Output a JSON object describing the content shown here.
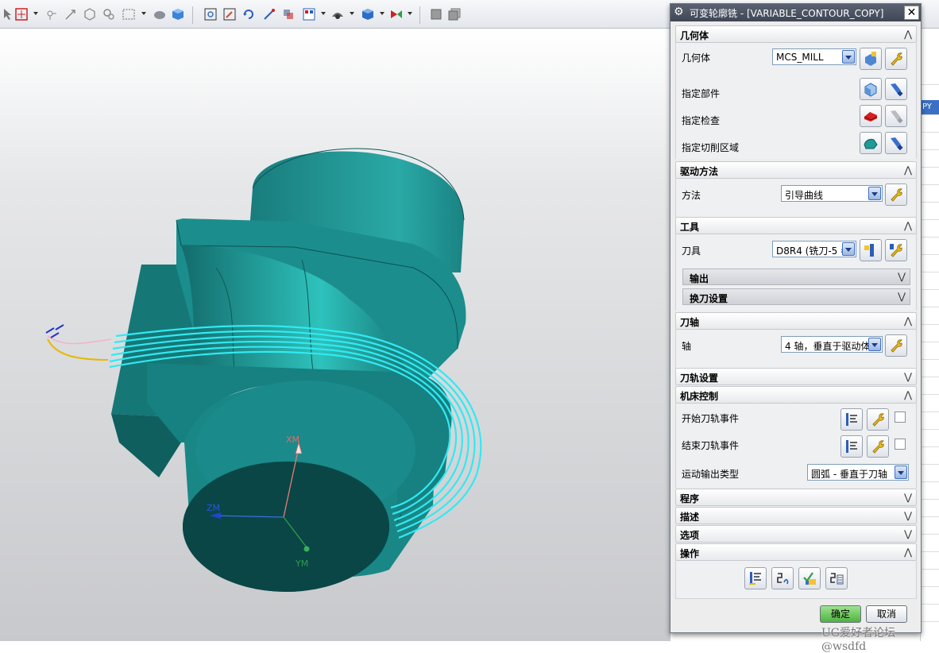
{
  "dialog": {
    "title": "可变轮廓铣 - [VARIABLE_CONTOUR_COPY]",
    "sections": {
      "geometry": {
        "label": "几何体",
        "geometry_label": "几何体",
        "geometry_value": "MCS_MILL",
        "part_label": "指定部件",
        "check_label": "指定检查",
        "cut_area_label": "指定切削区域"
      },
      "drive": {
        "label": "驱动方法",
        "method_label": "方法",
        "method_value": "引导曲线"
      },
      "tool": {
        "label": "工具",
        "tool_label": "刀具",
        "tool_value": "D8R4 (铣刀-5 参",
        "output_label": "输出",
        "change_label": "换刀设置"
      },
      "tool_axis": {
        "label": "刀轴",
        "axis_label": "轴",
        "axis_value": "4 轴，垂直于驱动体"
      },
      "path_settings": {
        "label": "刀轨设置"
      },
      "machine": {
        "label": "机床控制",
        "start_label": "开始刀轨事件",
        "end_label": "结束刀轨事件",
        "motion_label": "运动输出类型",
        "motion_value": "圆弧 - 垂直于刀轴"
      },
      "program": {
        "label": "程序"
      },
      "description": {
        "label": "描述"
      },
      "options": {
        "label": "选项"
      },
      "actions": {
        "label": "操作"
      }
    },
    "ok_label": "确定",
    "cancel_label": "取消"
  },
  "viewport": {
    "axis_x": "XM",
    "axis_y": "YM",
    "axis_z": "ZM"
  },
  "right_strip": {
    "highlight_text": "PY"
  },
  "watermark": "UG爱好者论坛@wsdfd",
  "colors": {
    "model": "#1b8a8a",
    "toolpath": "#2ee6f0",
    "dialog_title": "#4a5160",
    "ok_button": "#5cbf4c"
  }
}
